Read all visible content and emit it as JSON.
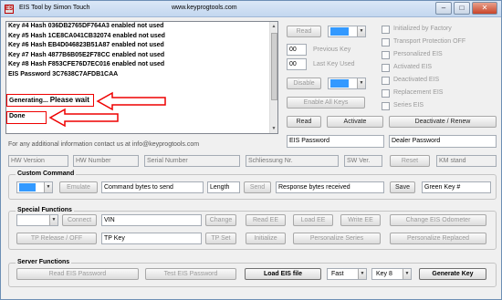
{
  "window": {
    "title": "EIS Tool by Simon Touch",
    "url": "www.keyprogtools.com",
    "icon_text": "ES",
    "minimize": "–",
    "maximize": "□",
    "close": "✕"
  },
  "log": {
    "lines": [
      "Key #4 Hash  036DB2765DF764A3  enabled  not used",
      "Key #5 Hash  1CE8CA041CB32074  enabled  not used",
      "Key #6 Hash  EB4D046823B51A87  enabled  not used",
      "Key #7 Hash  4877B6B05E2F78CC  enabled  not used",
      "Key #8 Hash  F853CFE76D7EC016  enabled  not used",
      "EIS Password  3C7638C7AFDB1CAA"
    ],
    "generating_prefix": "Generating...",
    "generating_suffix": "Please wait",
    "done": "Done"
  },
  "read_panel": {
    "read_label": "Read",
    "selected_value": "",
    "prev_key_value": "00",
    "prev_key_label": "Previous Key",
    "last_key_value": "00",
    "last_key_label": "Last Key Used",
    "disable_label": "Disable",
    "disable_select": "",
    "enable_all_label": "Enable All Keys",
    "read2_label": "Read",
    "activate_label": "Activate",
    "deactivate_label": "Deactivate / Renew",
    "eis_password_field": "EIS Password",
    "dealer_password_field": "Dealer Password"
  },
  "status_checks": [
    "Initialized by Factory",
    "Transport Protection OFF",
    "Personalized EIS",
    "Activated EIS",
    "Deactivated EIS",
    "Replacement EIS",
    "Series EIS"
  ],
  "info_text": "For any additional information contact us at info@keyprogtools.com",
  "info_row": {
    "hw_version": "HW Version",
    "hw_number": "HW Number",
    "serial_number": "Serial Number",
    "schliessung": "Schliessung Nr.",
    "sw_ver": "SW Ver.",
    "reset": "Reset",
    "km_stand": "KM stand"
  },
  "custom_command": {
    "title": "Custom Command",
    "emulate": "Emulate",
    "bytes_placeholder": "Command bytes to send",
    "length": "Length",
    "send": "Send",
    "response": "Response bytes received",
    "save": "Save",
    "green_key": "Green Key #"
  },
  "special_functions": {
    "title": "Special Functions",
    "connect": "Connect",
    "vin": "VIN",
    "change": "Change",
    "read_ee": "Read EE",
    "load_ee": "Load EE",
    "write_ee": "Write EE",
    "change_odometer": "Change EIS Odometer",
    "tp_release": "TP Release / OFF",
    "tp_key": "TP Key",
    "tp_set": "TP Set",
    "initialize": "Initialize",
    "personalize_series": "Personalize Series",
    "personalize_replaced": "Personalize Replaced"
  },
  "server_functions": {
    "title": "Server Functions",
    "read_eis_password": "Read EIS Password",
    "test_eis_password": "Test EIS Password",
    "load_eis_file": "Load EIS file",
    "speed": "Fast",
    "key": "Key 8",
    "generate_key": "Generate Key"
  },
  "colors": {
    "highlight_red": "#ee0000",
    "selection_blue": "#3399ff"
  }
}
